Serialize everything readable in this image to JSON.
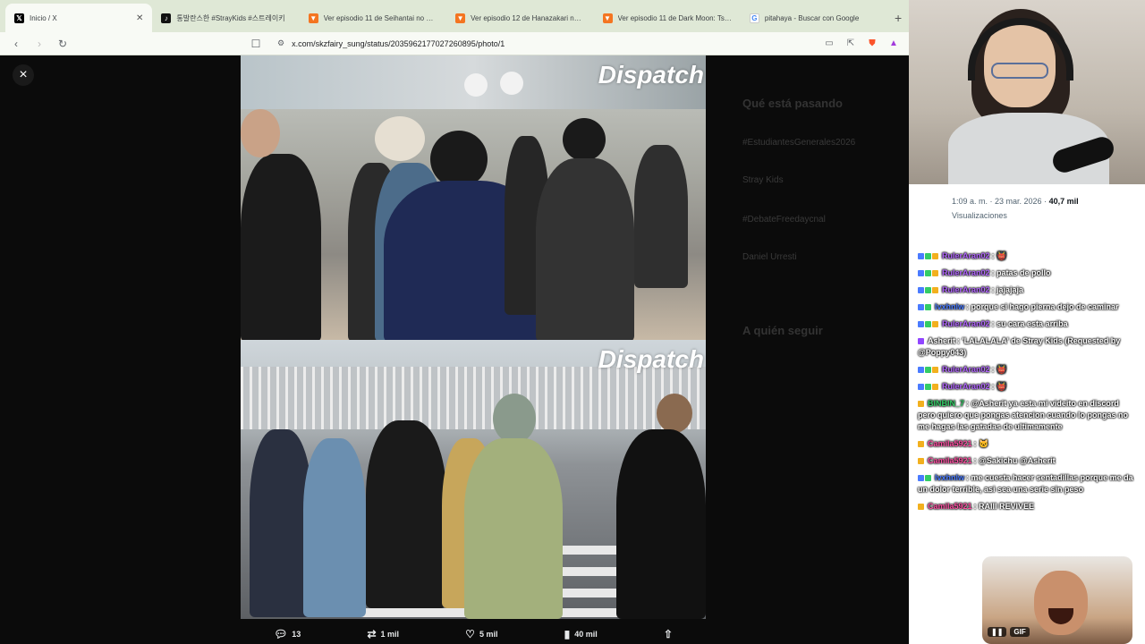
{
  "browser": {
    "tabs": [
      {
        "label": "Inicio / X",
        "icon": "x-logo-icon",
        "active": true
      },
      {
        "label": "통발란스한 #StrayKids #스트레이키",
        "icon": "tiktok-icon",
        "active": false
      },
      {
        "label": "Ver episodio 11 de Seihantai no Kim",
        "icon": "crunchyroll-icon",
        "active": false
      },
      {
        "label": "Ver episodio 12 de Hanazakari no Ki",
        "icon": "crunchyroll-icon",
        "active": false
      },
      {
        "label": "Ver episodio 11 de Dark Moon: Tsuk",
        "icon": "crunchyroll-icon",
        "active": false
      },
      {
        "label": "pitahaya - Buscar con Google",
        "icon": "google-icon",
        "active": false
      }
    ],
    "url": "x.com/skzfairy_sung/status/2035962177027260895/photo/1"
  },
  "viewer": {
    "background_text": {
      "right_heading": "Qué está pasando",
      "trend1": "#EstudiantesGenerales2026",
      "trend2": "Stray Kids",
      "trend3": "#DebateFreedaycnal",
      "trend4": "Daniel Urresti",
      "follow": "A quién seguir"
    },
    "watermark_top": "Dispatch",
    "watermark_bottom": "Dispatch",
    "actions": {
      "replies": "13",
      "reposts": "1 mil",
      "likes": "5 mil",
      "views": "40 mil"
    }
  },
  "stream": {
    "tweet_meta": {
      "time": "1:09 a. m. · 23 mar. 2026 · ",
      "views": "40,7 mil",
      "views_label": "Visualizaciones"
    },
    "chat": [
      {
        "user": "RulerAran02",
        "text": ": 👹",
        "color": "#b366ff"
      },
      {
        "user": "RulerAran02",
        "text": ": patas de pollo",
        "color": "#b366ff"
      },
      {
        "user": "RulerAran02",
        "text": ": jajajaja",
        "color": "#b366ff"
      },
      {
        "user": "lvxhnlw",
        "text": ": porque si hago pierna dejo de caminar",
        "color": "#4a7bff"
      },
      {
        "user": "RulerAran02",
        "text": ": su cara esta arriba",
        "color": "#b366ff"
      },
      {
        "user": "Asherit",
        "text": ": 'LALALALA' de Stray Kids (Requested by @Poppy043)",
        "color": "#ffffff"
      },
      {
        "user": "RulerAran02",
        "text": ": 👹",
        "color": "#b366ff"
      },
      {
        "user": "RulerAran02",
        "text": ": 👹",
        "color": "#b366ff"
      },
      {
        "user": "BINBIN_7",
        "text": ": @Asherit ya esta mi videito en discord pero quiero que pongas atencion cuando lo pongas no me hagas las gatadas de ultimamente",
        "color": "#33cc66"
      },
      {
        "user": "Camila5921",
        "text": ": 🐱",
        "color": "#ff4fa3"
      },
      {
        "user": "Camila5921",
        "text": ": @Sakichu @Asherit",
        "color": "#ff4fa3"
      },
      {
        "user": "lvxhnlw",
        "text": ": me cuesta hacer sentadillas porque me da un dolor terrible, asi sea una serie sin peso",
        "color": "#4a7bff"
      },
      {
        "user": "Camila5921",
        "text": ": RAIII REVIVEE",
        "color": "#ff4fa3"
      }
    ],
    "gif_label": "GIF"
  }
}
